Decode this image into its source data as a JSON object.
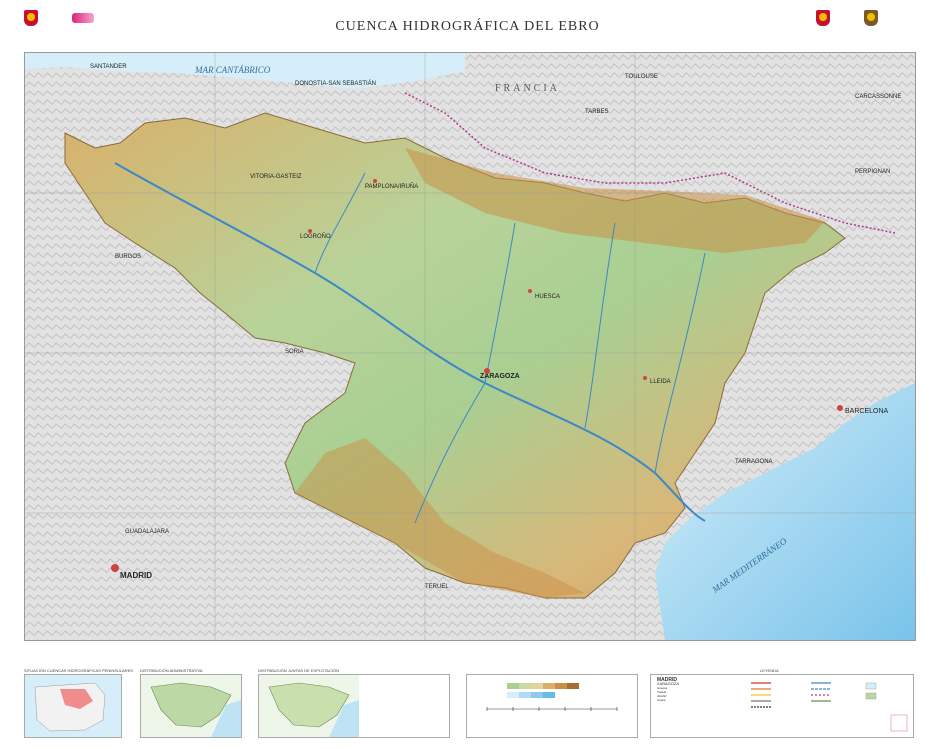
{
  "title": "CUENCA HIDROGRÁFICA DEL EBRO",
  "colors": {
    "basin_low": "#b9d7a2",
    "basin_mid": "#d9c58b",
    "basin_high": "#c98f45",
    "sea_deep": "#7ec8ec",
    "sea_shallow": "#d5eef9",
    "land_outside": "#dcdcdc",
    "border_dots": "#b23a8a"
  },
  "map": {
    "seas": [
      "MAR CANTÁBRICO",
      "MAR MEDITERRÁNEO"
    ],
    "countries": [
      "FRANCIA"
    ],
    "cities": [
      "SANTANDER",
      "DONOSTIA-SAN SEBASTIÁN",
      "VITORIA-GASTEIZ",
      "PAMPLONA/IRUÑA",
      "LOGROÑO",
      "BURGOS",
      "SORIA",
      "ZARAGOZA",
      "HUESCA",
      "LLEIDA",
      "BARCELONA",
      "TARRAGONA",
      "TERUEL",
      "MADRID",
      "GUADALAJARA",
      "TOULOUSE",
      "CARCASSONNE",
      "TARBES",
      "PERPIGNAN"
    ]
  },
  "footer": {
    "panel_titles": [
      "SITUACIÓN CUENCAS HIDROGRÁFICAS PENINSULARES",
      "DISTRIBUCIÓN ADMINISTRATIVA",
      "DISTRIBUCIÓN JUNTAS DE EXPLOTACIÓN",
      "LEYENDA"
    ],
    "legend_items": [
      "MADRID",
      "ZARAGOZA",
      "Huesca",
      "Tudela",
      "Alcañiz",
      "Caspe"
    ]
  }
}
